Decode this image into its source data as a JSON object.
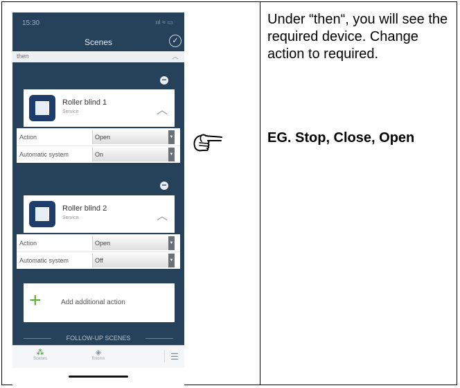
{
  "status": {
    "time": "15:30",
    "indicators": "ııl ≈ ▭"
  },
  "nav": {
    "title": "Scenes",
    "confirm_icon": "check-circle-icon"
  },
  "section": {
    "label": "then"
  },
  "devices": [
    {
      "name": "Roller blind 1",
      "subtitle": "Service",
      "rows": [
        {
          "label": "Action",
          "value": "Open"
        },
        {
          "label": "Automatic system",
          "value": "On"
        }
      ]
    },
    {
      "name": "Roller blind 2",
      "subtitle": "Service",
      "rows": [
        {
          "label": "Action",
          "value": "Open"
        },
        {
          "label": "Automatic system",
          "value": "Off"
        }
      ]
    }
  ],
  "add_action": {
    "label": "Add additional action"
  },
  "followup": {
    "label": "FOLLOW-UP SCENES"
  },
  "tabs": [
    {
      "label": "Scenes",
      "icon": "scenes-icon"
    },
    {
      "label": "Rooms",
      "icon": "rooms-icon"
    },
    {
      "label": "",
      "icon": "menu-icon"
    }
  ],
  "colors": {
    "app_bg": "#26425b",
    "accent_green": "#5bb12f",
    "device_icon": "#1f3d6b"
  },
  "instructions": {
    "text": "Under “then“, you will see the required device. Change action to required.",
    "example": "EG. Stop, Close, Open"
  }
}
